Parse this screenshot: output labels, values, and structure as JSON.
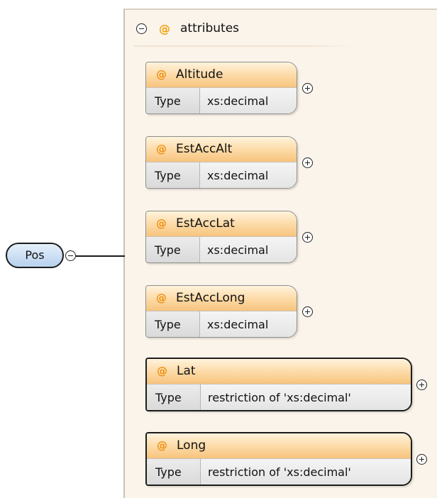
{
  "root": {
    "label": "Pos"
  },
  "group": {
    "label": "attributes",
    "at_symbol": "@"
  },
  "type_key_label": "Type",
  "attributes": [
    {
      "name": "Altitude",
      "type": "xs:decimal"
    },
    {
      "name": "EstAccAlt",
      "type": "xs:decimal"
    },
    {
      "name": "EstAccLat",
      "type": "xs:decimal"
    },
    {
      "name": "EstAccLong",
      "type": "xs:decimal"
    },
    {
      "name": "Lat",
      "type": "restriction of 'xs:decimal'"
    },
    {
      "name": "Long",
      "type": "restriction of 'xs:decimal'"
    }
  ],
  "colors": {
    "attribute_header": "#fcd9a4",
    "attribute_symbol": "#f09010",
    "panel_background": "#fbf4ea",
    "root_node": "#b7d1ee"
  },
  "icons": {
    "collapse": "minus-circle-icon",
    "expand": "plus-circle-icon"
  }
}
